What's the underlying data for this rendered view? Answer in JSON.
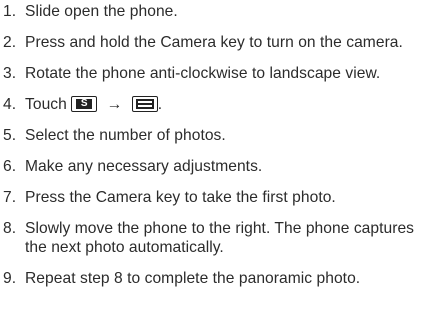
{
  "steps": [
    {
      "num": "1.",
      "text": "Slide open the phone."
    },
    {
      "num": "2.",
      "text": "Press and hold the Camera key to turn on the camera."
    },
    {
      "num": "3.",
      "text": "Rotate the phone anti-clockwise to landscape view."
    },
    {
      "num": "4.",
      "text_before": "Touch",
      "arrow": "→",
      "text_after": ".",
      "icons": [
        "mode-key-icon",
        "panorama-icon"
      ],
      "mode_key_label": "S"
    },
    {
      "num": "5.",
      "text": "Select the number of photos."
    },
    {
      "num": "6.",
      "text": "Make any necessary adjustments."
    },
    {
      "num": "7.",
      "text": "Press the Camera key to take the first photo."
    },
    {
      "num": "8.",
      "text": "Slowly move the phone to the right. The phone captures the next photo automatically."
    },
    {
      "num": "9.",
      "text": "Repeat step 8 to complete the panoramic photo."
    }
  ]
}
